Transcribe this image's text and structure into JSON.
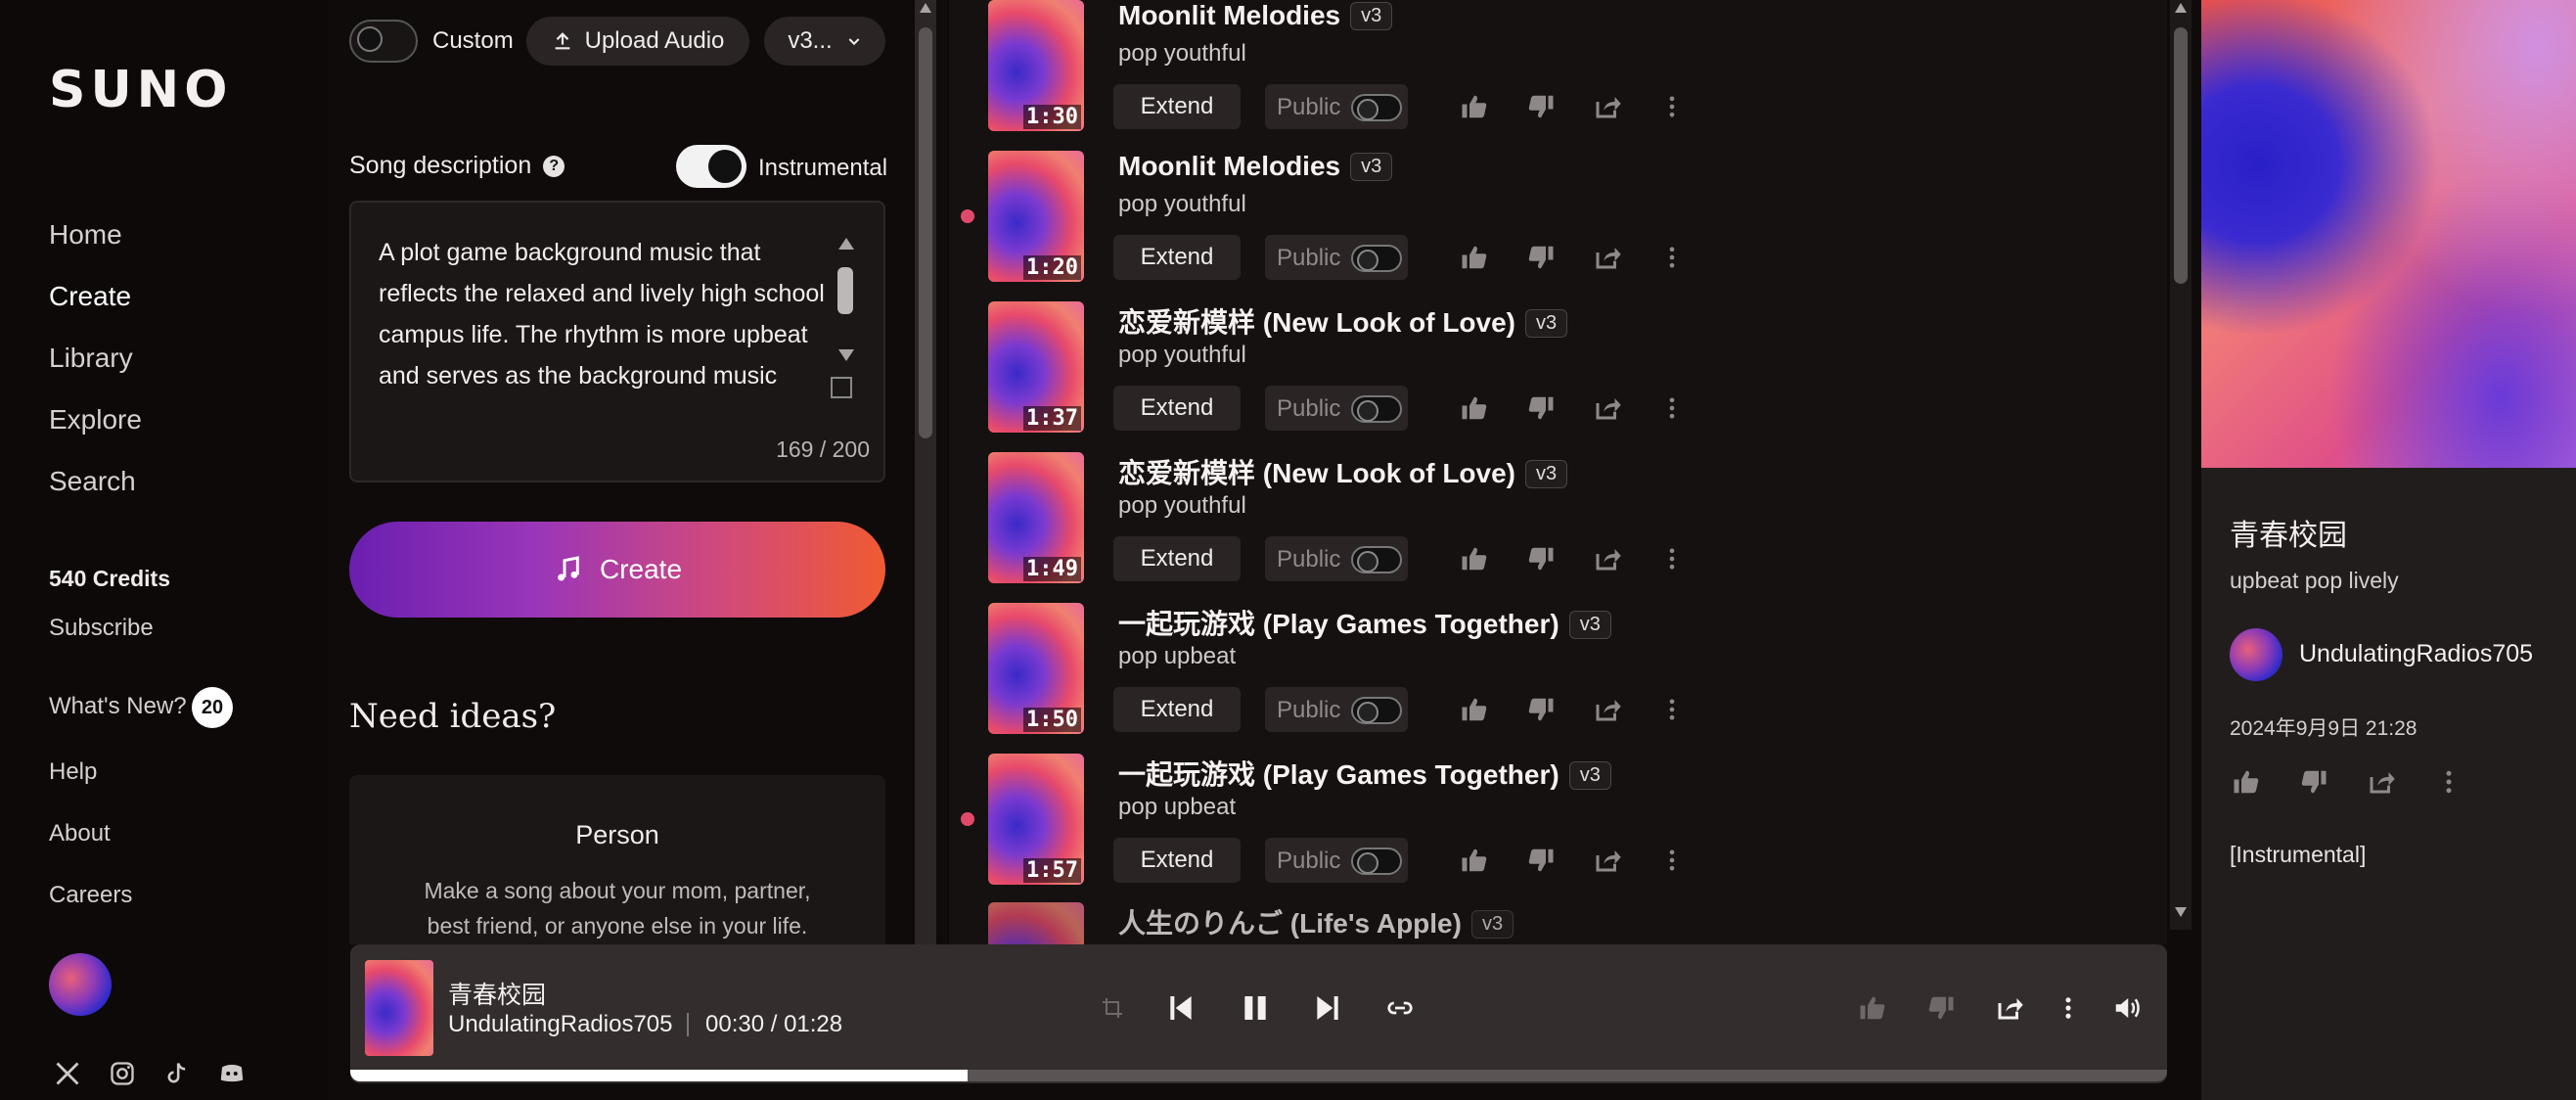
{
  "app": {
    "logo": "SUNO"
  },
  "nav": {
    "items": [
      {
        "label": "Home"
      },
      {
        "label": "Create"
      },
      {
        "label": "Library"
      },
      {
        "label": "Explore"
      },
      {
        "label": "Search"
      }
    ],
    "credits": "540 Credits",
    "subscribe": "Subscribe",
    "whats_new": "What's New?",
    "whats_new_count": "20",
    "help": "Help",
    "about": "About",
    "careers": "Careers",
    "social_icons": [
      "x-icon",
      "instagram-icon",
      "tiktok-icon",
      "discord-icon"
    ]
  },
  "create": {
    "custom_label": "Custom",
    "upload_label": "Upload Audio",
    "model_label": "v3...",
    "song_description_label": "Song description",
    "instrumental_label": "Instrumental",
    "description_text": "A plot game background music that reflects the relaxed and lively high school campus life. The rhythm is more upbeat and serves as the background music",
    "char_count": "169 / 200",
    "create_label": "Create",
    "need_ideas": "Need ideas?",
    "idea_card": {
      "title": "Person",
      "description": "Make a song about your mom, partner, best friend, or anyone else in your life."
    }
  },
  "songs": [
    {
      "title": "Moonlit Melodies",
      "version": "v3",
      "tags": "pop youthful",
      "duration": "1:30",
      "extend": "Extend",
      "public": "Public",
      "new": false
    },
    {
      "title": "Moonlit Melodies",
      "version": "v3",
      "tags": "pop youthful",
      "duration": "1:20",
      "extend": "Extend",
      "public": "Public",
      "new": true
    },
    {
      "title": "恋爱新模样 (New Look of Love)",
      "version": "v3",
      "tags": "pop youthful",
      "duration": "1:37",
      "extend": "Extend",
      "public": "Public",
      "new": false
    },
    {
      "title": "恋爱新模样 (New Look of Love)",
      "version": "v3",
      "tags": "pop youthful",
      "duration": "1:49",
      "extend": "Extend",
      "public": "Public",
      "new": false
    },
    {
      "title": "一起玩游戏 (Play Games Together)",
      "version": "v3",
      "tags": "pop upbeat",
      "duration": "1:50",
      "extend": "Extend",
      "public": "Public",
      "new": false
    },
    {
      "title": "一起玩游戏 (Play Games Together)",
      "version": "v3",
      "tags": "pop upbeat",
      "duration": "1:57",
      "extend": "Extend",
      "public": "Public",
      "new": true
    },
    {
      "title": "人生のりんご (Life's Apple)",
      "version": "v3",
      "tags": "",
      "duration": "",
      "extend": "",
      "public": "",
      "new": false
    }
  ],
  "detail": {
    "title": "青春校园",
    "tags": "upbeat pop lively",
    "user": "UndulatingRadios705",
    "date": "2024年9月9日 21:28",
    "lyrics": "[Instrumental]"
  },
  "player": {
    "title": "青春校园",
    "user": "UndulatingRadios705",
    "time": "00:30 / 01:28",
    "progress": 0.34
  },
  "colors": {
    "accent_gradient_start": "#6a1fb0",
    "accent_gradient_end": "#f05a32",
    "new_dot": "#e04a6a"
  }
}
